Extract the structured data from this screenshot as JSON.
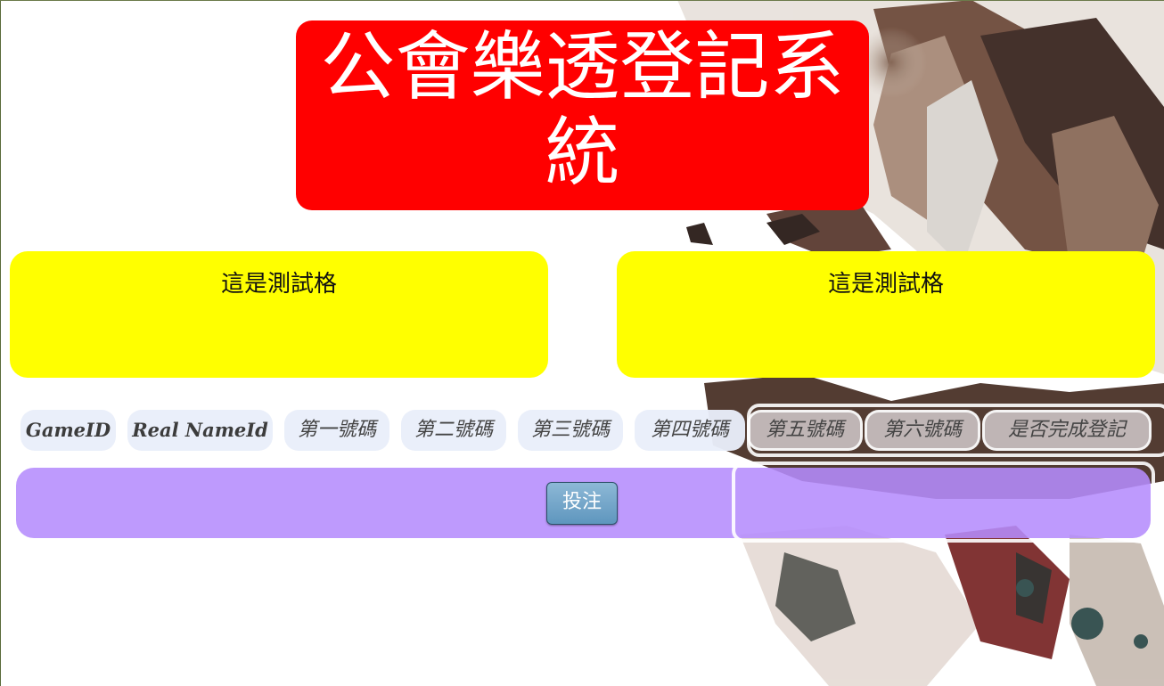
{
  "title": "公會樂透登記系統",
  "panels": {
    "left_text": "這是測試格",
    "right_text": "這是測試格"
  },
  "columns": [
    "GameID",
    "Real NameId",
    "第一號碼",
    "第二號碼",
    "第三號碼",
    "第四號碼",
    "第五號碼",
    "第六號碼",
    "是否完成登記"
  ],
  "bet_button": "投注",
  "colors": {
    "title_bg": "#ff0000",
    "panel_bg": "#ffff00",
    "bet_bar_bg": "#b58cfd",
    "header_bg": "#e9eefa",
    "button_bg": "#6fa3c8"
  }
}
